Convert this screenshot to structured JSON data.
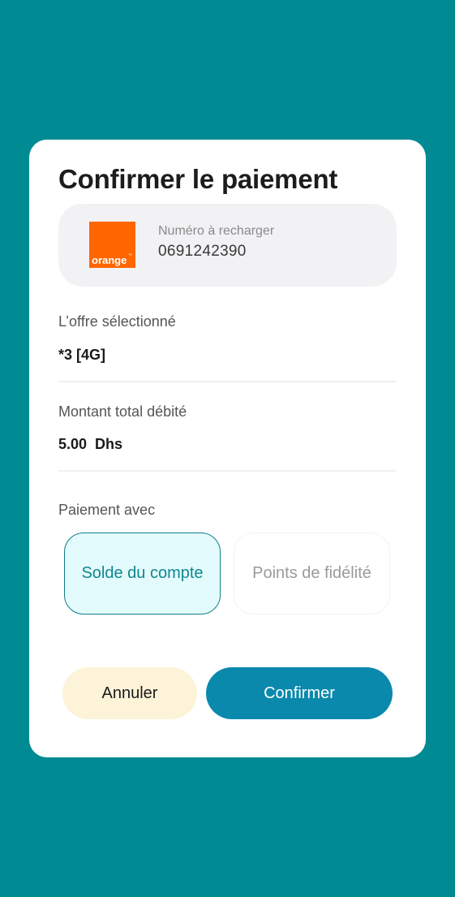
{
  "dialog": {
    "title": "Confirmer le paiement",
    "operator": {
      "logo_text": "orange",
      "logo_mark": "™",
      "brand_color": "#FF6600"
    },
    "number_label": "Numéro à recharger",
    "number_value": "0691242390",
    "offer_label": "L’offre sélectionné",
    "offer_value": "*3 [4G]",
    "amount_label": "Montant total débité",
    "amount_value": "5.00  Dhs",
    "payment_label": "Paiement avec",
    "payment_options": [
      {
        "label": "Solde du compte",
        "selected": true
      },
      {
        "label": "Points de fidélité",
        "selected": false
      }
    ],
    "cancel_label": "Annuler",
    "confirm_label": "Confirmer"
  },
  "colors": {
    "background": "#008A93",
    "accent": "#0A89AD",
    "selected_border": "#0E7F88",
    "cancel_bg": "#FCF3D9"
  }
}
